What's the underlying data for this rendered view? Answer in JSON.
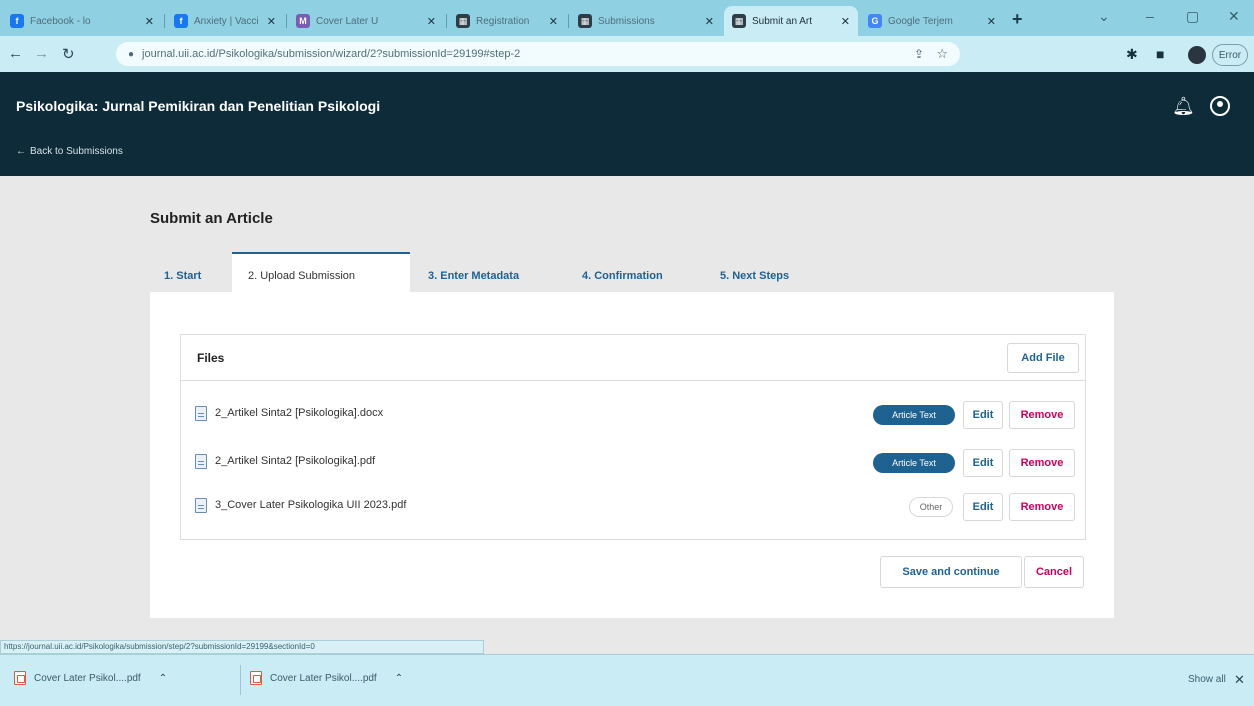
{
  "browser": {
    "tabs": [
      {
        "label": "Facebook - lo",
        "fav_color": "#1877f2",
        "fav_glyph": "f"
      },
      {
        "label": "Anxiety | Vacci",
        "fav_color": "#1877f2",
        "fav_glyph": "f"
      },
      {
        "label": "Cover Later U",
        "fav_color": "#7a5bb5",
        "fav_glyph": "M"
      },
      {
        "label": "Registration",
        "fav_color": "#2f3e46",
        "fav_glyph": "▦"
      },
      {
        "label": "Submissions",
        "fav_color": "#2f3e46",
        "fav_glyph": "▦"
      },
      {
        "label": "Submit an Art",
        "fav_color": "#2f3e46",
        "fav_glyph": "▦"
      },
      {
        "label": "Google Terjem",
        "fav_color": "#4285f4",
        "fav_glyph": "G"
      }
    ],
    "new_tab": "+",
    "url": "journal.uii.ac.id/Psikologika/submission/wizard/2?submissionId=29199#step-2",
    "error_label": "Error",
    "status_url": "https://journal.uii.ac.id/Psikologika/submission/step/2?submissionId=29199&sectionId=0"
  },
  "header": {
    "title": "Psikologika: Jurnal Pemikiran dan Penelitian Psikologi",
    "back_link": "Back to Submissions",
    "back_arrow": "←"
  },
  "main": {
    "page_title": "Submit an Article",
    "steps": [
      {
        "label": "1. Start"
      },
      {
        "label": "2. Upload Submission"
      },
      {
        "label": "3. Enter Metadata"
      },
      {
        "label": "4. Confirmation"
      },
      {
        "label": "5. Next Steps"
      }
    ],
    "files": {
      "title": "Files",
      "add_label": "Add File",
      "rows": [
        {
          "name": "2_Artikel Sinta2 [Psikologika].docx",
          "badge": "Article Text",
          "edit": "Edit",
          "remove": "Remove"
        },
        {
          "name": "2_Artikel Sinta2 [Psikologika].pdf",
          "badge": "Article Text",
          "edit": "Edit",
          "remove": "Remove"
        },
        {
          "name": "3_Cover Later Psikologika UII 2023.pdf",
          "badge": "Other",
          "edit": "Edit",
          "remove": "Remove"
        }
      ]
    },
    "save_label": "Save and continue",
    "cancel_label": "Cancel"
  },
  "downloads": {
    "items": [
      {
        "label": "Cover Later Psikol....pdf"
      },
      {
        "label": "Cover Later Psikol....pdf"
      }
    ],
    "show_all": "Show all",
    "close": "✕"
  }
}
